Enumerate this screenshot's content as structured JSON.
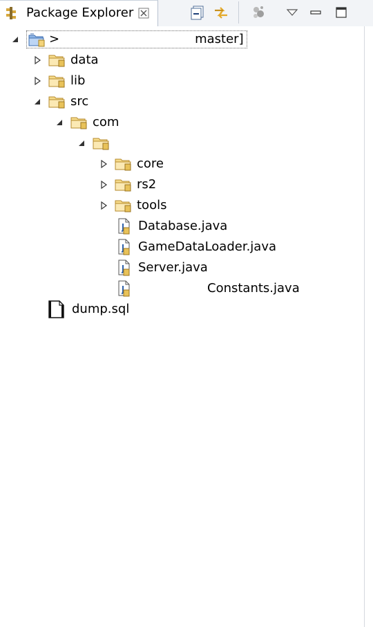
{
  "view": {
    "title": "Package Explorer",
    "toolbar": [
      "collapse-all",
      "link-with-editor",
      "focus-on-active-task",
      "view-menu",
      "minimize",
      "maximize"
    ]
  },
  "tree": {
    "project": {
      "prefix": ">",
      "suffix": "master]"
    },
    "folders": {
      "data": "data",
      "lib": "lib",
      "src": "src",
      "com": "com",
      "core": "core",
      "rs2": "rs2",
      "tools": "tools"
    },
    "files": {
      "database": "Database.java",
      "gamedataloader": "GameDataLoader.java",
      "server": "Server.java",
      "constants": "Constants.java",
      "dump": "dump.sql"
    }
  },
  "colors": {
    "folder": "#f3d37a",
    "folder_edge": "#c09a3a",
    "java_blue": "#2c5fa8",
    "tab_border": "#b7c2d0"
  }
}
